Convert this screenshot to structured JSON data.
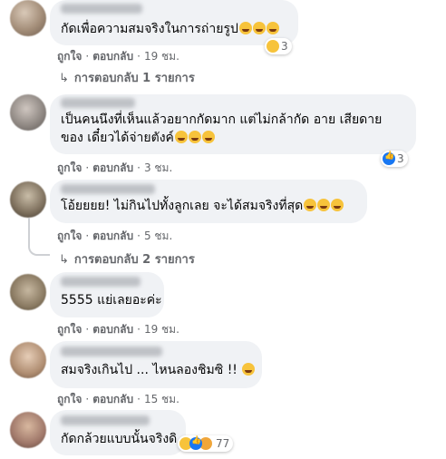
{
  "comments": [
    {
      "text": "กัดเพื่อความสมจริงในการถ่ายรูป",
      "reaction_count": "3",
      "like_label": "ถูกใจ",
      "reply_label": "ตอบกลับ",
      "time": "19 ชม.",
      "replies_link": "การตอบกลับ 1 รายการ"
    },
    {
      "text_line1": "เป็นคนนึงที่เห็นแล้วอยากกัดมาก แต่ไม่กล้ากัด อาย เสียดาย",
      "text_line2": "ของ เดี๋ยวได้จ่ายตังค์",
      "reaction_count": "3",
      "like_label": "ถูกใจ",
      "reply_label": "ตอบกลับ",
      "time": "3 ชม."
    },
    {
      "text": "โอ้ยยยย! ไม่กินไปทั้งลูกเลย จะได้สมจริงที่สุด",
      "like_label": "ถูกใจ",
      "reply_label": "ตอบกลับ",
      "time": "5 ชม.",
      "replies_link": "การตอบกลับ 2 รายการ"
    },
    {
      "text": "5555 แย่เลยอะค่ะ",
      "like_label": "ถูกใจ",
      "reply_label": "ตอบกลับ",
      "time": "19 ชม."
    },
    {
      "text": "สมจริงเกินไป ... ไหนลองชิมซิ !!",
      "like_label": "ถูกใจ",
      "reply_label": "ตอบกลับ",
      "time": "15 ชม."
    },
    {
      "text": "กัดกล้วยแบบนั้นจริงดิ",
      "reaction_count": "77"
    }
  ],
  "colors": {
    "bubble_bg": "#f0f2f5",
    "meta_text": "#65676b",
    "like_blue": "#1877f2",
    "emoji_yellow": "#f7c33b"
  },
  "icons": {
    "reply_arrow": "reply-arrow-icon",
    "haha": "haha-emoji-icon",
    "like": "like-thumb-icon"
  }
}
